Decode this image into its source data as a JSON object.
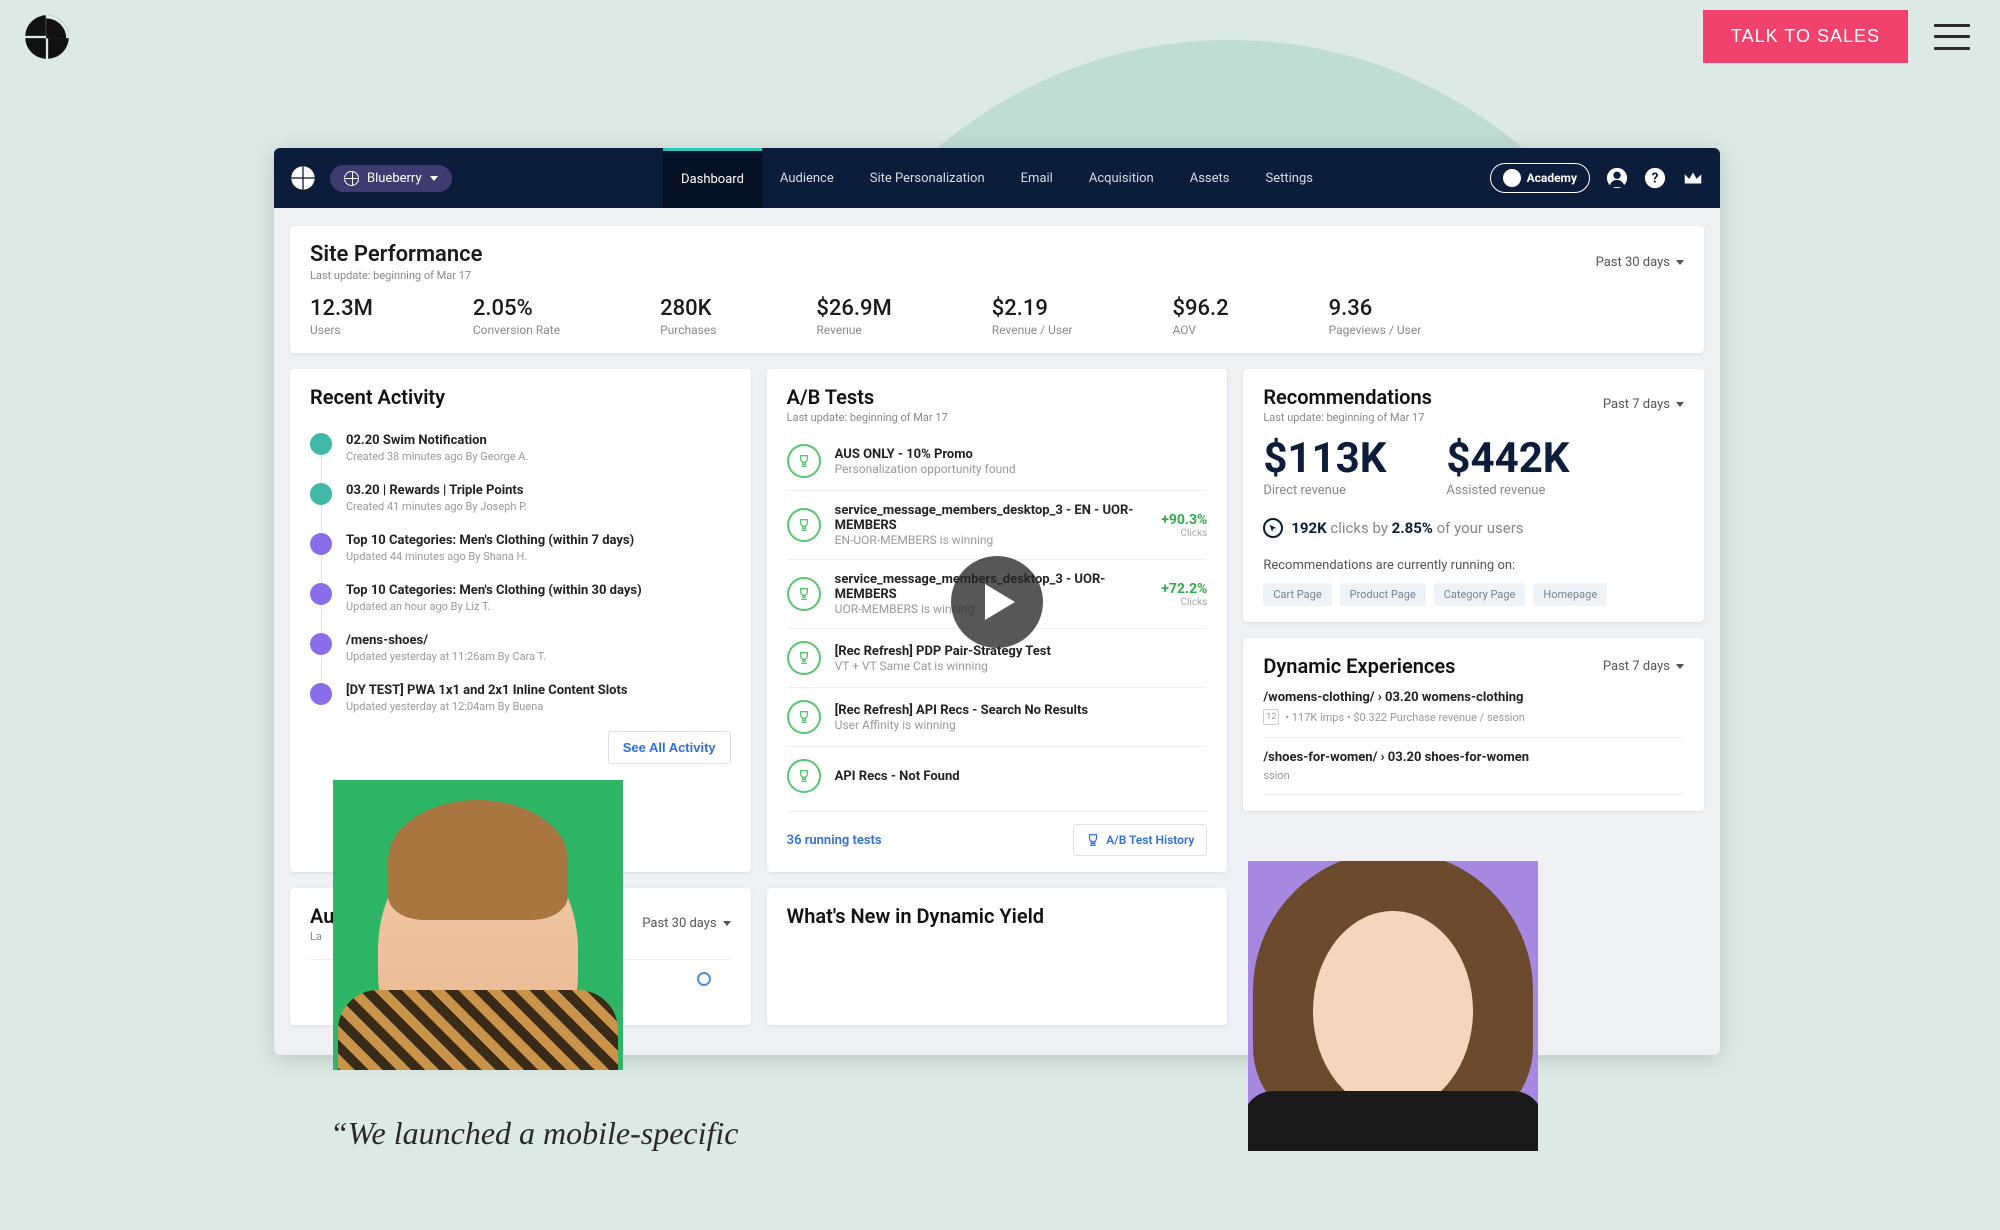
{
  "outer": {
    "cta": "TALK TO SALES"
  },
  "quote": "“We launched a mobile-specific",
  "dash": {
    "account": "Blueberry",
    "nav": {
      "dashboard": "Dashboard",
      "audience": "Audience",
      "site": "Site Personalization",
      "email": "Email",
      "acq": "Acquisition",
      "assets": "Assets",
      "settings": "Settings"
    },
    "academy": "Academy"
  },
  "sitePerf": {
    "title": "Site Performance",
    "update": "Last update: beginning of Mar 17",
    "range": "Past 30 days",
    "metrics": [
      {
        "val": "12.3M",
        "lbl": "Users"
      },
      {
        "val": "2.05%",
        "lbl": "Conversion Rate"
      },
      {
        "val": "280K",
        "lbl": "Purchases"
      },
      {
        "val": "$26.9M",
        "lbl": "Revenue"
      },
      {
        "val": "$2.19",
        "lbl": "Revenue / User"
      },
      {
        "val": "$96.2",
        "lbl": "AOV"
      },
      {
        "val": "9.36",
        "lbl": "Pageviews / User"
      }
    ]
  },
  "recent": {
    "title": "Recent Activity",
    "seeAll": "See All Activity",
    "items": [
      {
        "t": "02.20 Swim Notification",
        "s": "Created 38 minutes ago By George A.",
        "c": "teal"
      },
      {
        "t": "03.20 | Rewards | Triple Points",
        "s": "Created 41 minutes ago By Joseph P.",
        "c": "teal"
      },
      {
        "t": "Top 10 Categories: Men's Clothing (within 7 days)",
        "s": "Updated 44 minutes ago By Shana H.",
        "c": "purple"
      },
      {
        "t": "Top 10 Categories: Men's Clothing (within 30 days)",
        "s": "Updated an hour ago By Liz T.",
        "c": "purple"
      },
      {
        "t": "/mens-shoes/",
        "s": "Updated yesterday at 11:26am By Cara T.",
        "c": "purple"
      },
      {
        "t": "[DY TEST] PWA 1x1 and 2x1 Inline Content Slots",
        "s": "Updated yesterday at 12:04am By Buena",
        "c": "purple"
      }
    ]
  },
  "ab": {
    "title": "A/B Tests",
    "update": "Last update: beginning of Mar 17",
    "rows": [
      {
        "t": "AUS ONLY - 10% Promo",
        "s": "Personalization opportunity found",
        "pct": "",
        "clk": ""
      },
      {
        "t": "service_message_members_desktop_3 - EN - UOR-MEMBERS",
        "s": "EN-UOR-MEMBERS is winning",
        "pct": "+90.3%",
        "clk": "Clicks"
      },
      {
        "t": "service_message_members_desktop_3 - UOR-MEMBERS",
        "s": "UOR-MEMBERS is winning",
        "pct": "+72.2%",
        "clk": "Clicks"
      },
      {
        "t": "[Rec Refresh] PDP Pair-Strategy Test",
        "s": "VT + VT Same Cat is winning",
        "pct": "",
        "clk": ""
      },
      {
        "t": "[Rec Refresh] API Recs - Search No Results",
        "s": "User Affinity is winning",
        "pct": "",
        "clk": ""
      },
      {
        "t": "API Recs - Not Found",
        "s": "",
        "pct": "",
        "clk": ""
      }
    ],
    "running": "36 running tests",
    "history": "A/B Test History"
  },
  "reco": {
    "title": "Recommendations",
    "update": "Last update: beginning of Mar 17",
    "range": "Past 7 days",
    "direct": {
      "val": "$113K",
      "lbl": "Direct revenue"
    },
    "assisted": {
      "val": "$442K",
      "lbl": "Assisted revenue"
    },
    "clicksNum": "192K",
    "clicksMid": " clicks by ",
    "clicksPct": "2.85%",
    "clicksEnd": " of your users",
    "runningOn": "Recommendations are currently running on:",
    "pills": [
      "Cart Page",
      "Product Page",
      "Category Page",
      "Homepage"
    ]
  },
  "dynexp": {
    "title": "Dynamic Experiences",
    "range": "Past 7 days",
    "items": [
      {
        "t": "/womens-clothing/ › 03.20 womens-clothing",
        "badge": "12",
        "s": "117K imps  •  $0.322 Purchase revenue / session"
      },
      {
        "t": "/shoes-for-women/ › 03.20 shoes-for-women",
        "badge": "",
        "s": "ssion"
      }
    ]
  },
  "aud": {
    "title": "Au",
    "update": "La",
    "range": "Past 30 days"
  },
  "whatsnew": {
    "title": "What's New in Dynamic Yield"
  }
}
